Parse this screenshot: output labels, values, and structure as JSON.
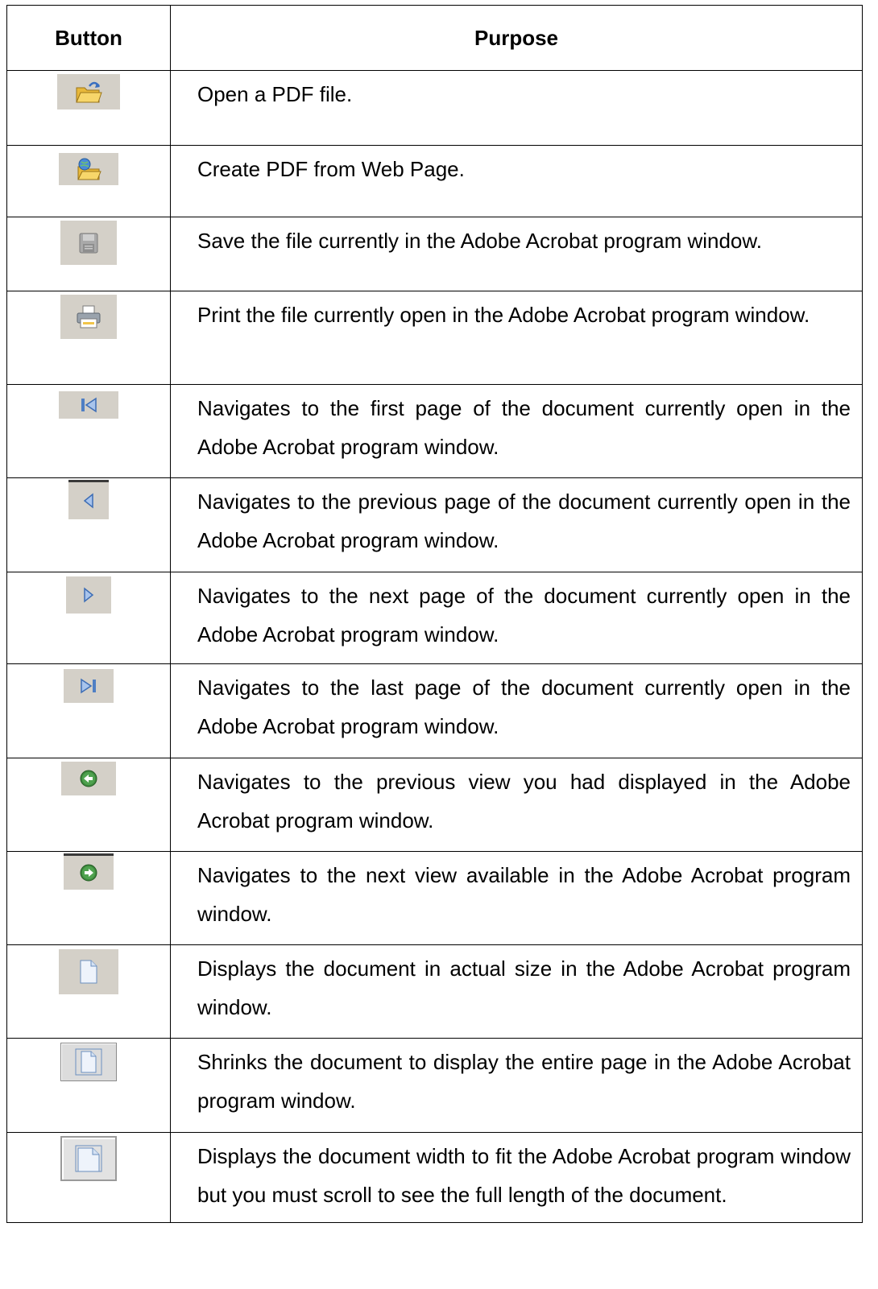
{
  "table": {
    "headers": {
      "button": "Button",
      "purpose": "Purpose"
    },
    "rows": [
      {
        "icon": "open-folder-icon",
        "purpose": "Open a PDF file."
      },
      {
        "icon": "create-pdf-web-icon",
        "purpose": "Create PDF from Web Page."
      },
      {
        "icon": "save-disk-icon",
        "purpose": "Save the file currently in the Adobe Acrobat program window."
      },
      {
        "icon": "printer-icon",
        "purpose": "Print the file currently open in the Adobe Acrobat program window."
      },
      {
        "icon": "first-page-icon",
        "purpose": "Navigates to the first page of the document currently open in the Adobe Acrobat program window."
      },
      {
        "icon": "previous-page-icon",
        "purpose": "Navigates to the previous page of the document currently open in the Adobe Acrobat program window."
      },
      {
        "icon": "next-page-icon",
        "purpose": "Navigates to the next page of the document currently open in the Adobe Acrobat program window."
      },
      {
        "icon": "last-page-icon",
        "purpose": "Navigates to the last page of the document currently open in the Adobe Acrobat program window."
      },
      {
        "icon": "previous-view-icon",
        "purpose": "Navigates to the previous view you had displayed in the Adobe Acrobat program window."
      },
      {
        "icon": "next-view-icon",
        "purpose": "Navigates to the next view available in the Adobe Acrobat program window."
      },
      {
        "icon": "actual-size-icon",
        "purpose": "Displays the document in actual size in the Adobe Acrobat program window."
      },
      {
        "icon": "fit-page-icon",
        "purpose": "Shrinks the document to display the entire page in the Adobe Acrobat program window."
      },
      {
        "icon": "fit-width-icon",
        "purpose": "Displays the document width to fit the Adobe Acrobat program window but you must scroll to see the full length of the document."
      }
    ]
  },
  "colors": {
    "icon_background": "#d4d0c8",
    "nav_blue": "#5a86c8",
    "view_green": "#3e8a3e",
    "folder_yellow": "#f2c84b"
  }
}
